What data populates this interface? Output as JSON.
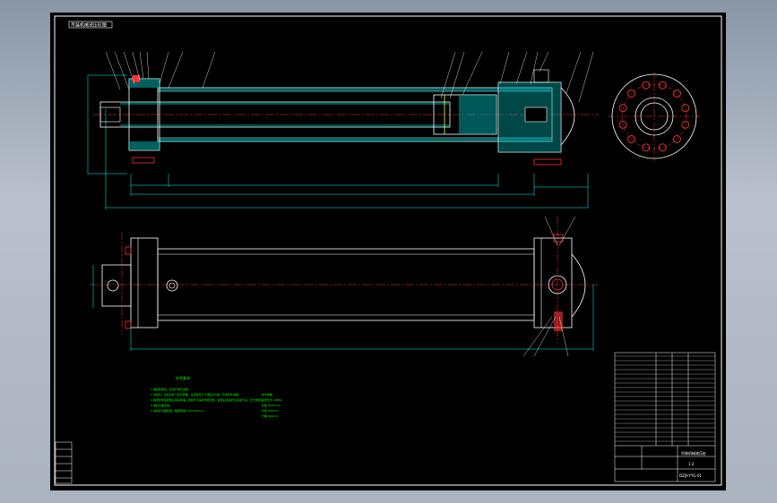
{
  "drawing": {
    "title_tag": "吊装机械液压缸图",
    "colors": {
      "background": "#000000",
      "outline": "#ffffff",
      "centerline": "#ff3030",
      "dimension": "#00ffff",
      "hatch": "#00c8c8",
      "leader": "#ffff00",
      "bolt": "#ff3030",
      "tech_text": "#00ff00",
      "frame": "#ffffff"
    }
  },
  "tech_requirements": {
    "heading": "技术要求",
    "lines": [
      "1.油缸装配后，应进行耐压试验。",
      "2.试压时，活塞应处于缸筒两端，在试验压力下保压5分钟，不得有外渗漏。",
      "3.各密封件装配前应涂润滑油，装配时不得损伤密封件，装配后活塞杆应运动灵活，无卡滞现象。",
      "4.油缸表面涂漆。",
      "5.活塞杆表面镀铬，铬层厚度0.03-0.05mm。"
    ],
    "params_heading": "技术参数",
    "params": [
      "工作压力 16MPa",
      "缸径 Φ125mm",
      "杆径 Φ70mm",
      "行程 800mm"
    ]
  },
  "title_block": {
    "drawing_name": "吊装机械液压缸",
    "drawing_no": "DZJX-YYG-01",
    "scale": "1:2"
  }
}
